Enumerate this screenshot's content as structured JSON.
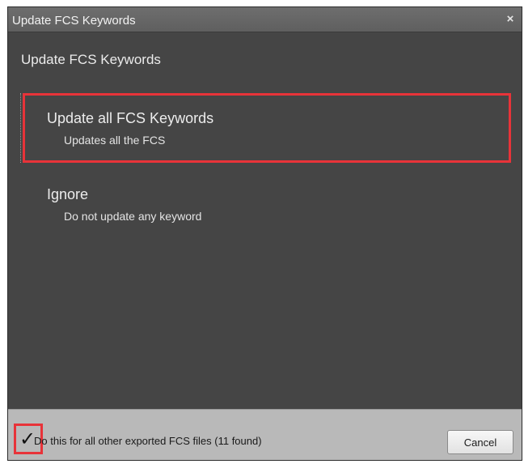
{
  "window": {
    "title": "Update FCS Keywords",
    "close_symbol": "×"
  },
  "dialog": {
    "heading": "Update FCS Keywords",
    "options": [
      {
        "title": "Update all FCS Keywords",
        "description": "Updates all the FCS",
        "selected": true
      },
      {
        "title": "Ignore",
        "description": "Do not update any keyword",
        "selected": false
      }
    ]
  },
  "footer": {
    "checkbox_label": "Do this for all other exported FCS files (11 found)",
    "checkbox_checked": true,
    "check_symbol": "✓",
    "cancel_label": "Cancel"
  },
  "colors": {
    "window_bg": "#454545",
    "titlebar_bg": "#666666",
    "footer_bg": "#b9b9b9",
    "highlight": "#e83339"
  },
  "icons": {
    "close": "close-icon",
    "check": "checkmark-icon"
  }
}
